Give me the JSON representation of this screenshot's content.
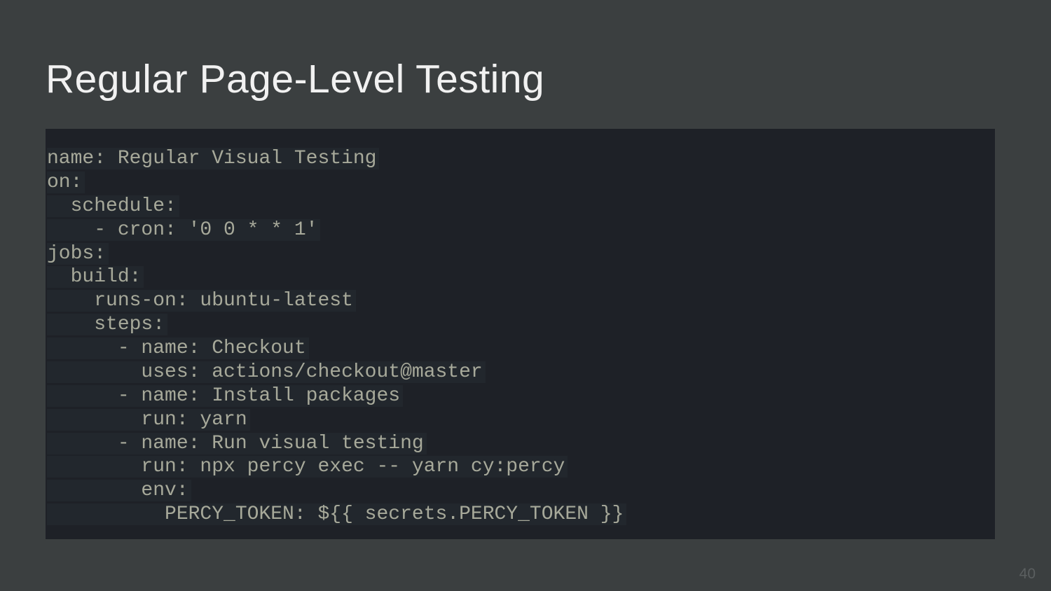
{
  "title": "Regular Page-Level Testing",
  "page_number": "40",
  "code": {
    "l1": "name: Regular Visual Testing",
    "l2": "on:",
    "l3": "  schedule:",
    "l4": "    - cron: '0 0 * * 1'",
    "l5": "jobs:",
    "l6": "  build:",
    "l7": "    runs-on: ubuntu-latest",
    "l8": "    steps:",
    "l9": "      - name: Checkout",
    "l10": "        uses: actions/checkout@master",
    "l11": "      - name: Install packages",
    "l12": "        run: yarn",
    "l13": "      - name: Run visual testing",
    "l14": "        run: npx percy exec -- yarn cy:percy",
    "l15": "        env:",
    "l16": "          PERCY_TOKEN: ${{ secrets.PERCY_TOKEN }}"
  }
}
